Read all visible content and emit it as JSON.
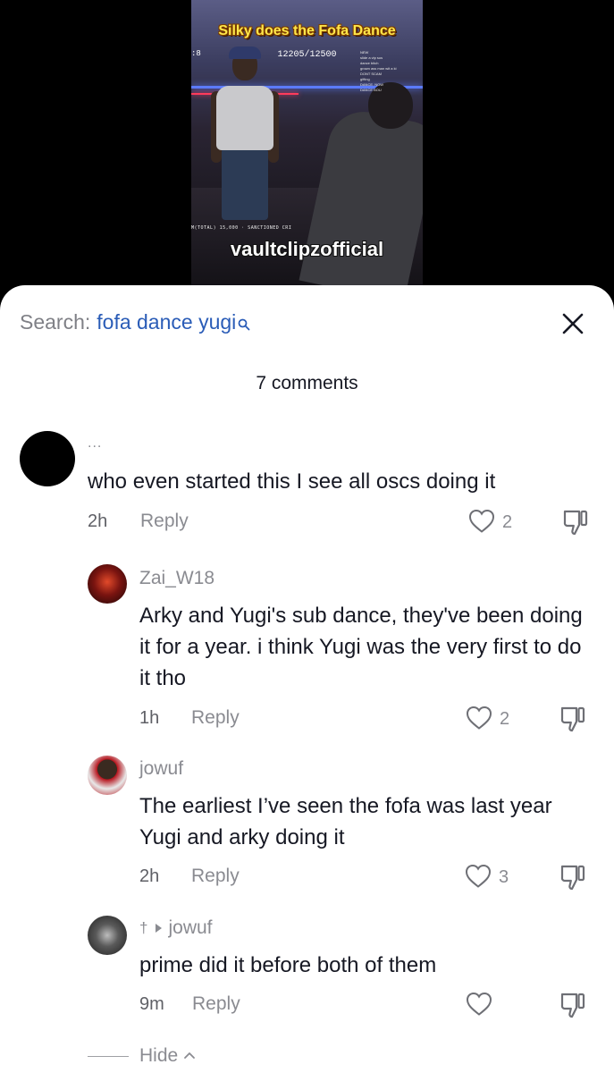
{
  "video": {
    "title": "Silky does the Fofa Dance",
    "counter": "12205/12500",
    "edge_mark": ":8",
    "overlay_text": "M(TOTAL) 15,000 · SANCTIONED CRI",
    "chat_lines": [
      "NEW",
      "slide a vip sus",
      "dance bitch",
      "grown ass man wit a ki",
      "DONT SCAM",
      "gifting",
      "DANCE. NOW",
      "DANCE BOU"
    ],
    "watermark": "vaultclipzofficial"
  },
  "sheet": {
    "search_prefix": "Search:",
    "search_term": "fofa dance yugi",
    "comment_count": "7 comments",
    "hide_label": "Hide",
    "reply_label": "Reply"
  },
  "comments": [
    {
      "user": "...",
      "text": "who even started this I see all oscs doing it",
      "time": "2h",
      "likes": "2",
      "avatar_color": "#000000"
    },
    {
      "user": "Zai_W18",
      "text": "Arky and Yugi's sub dance, they've been doing it for a year. i think Yugi was the very first to do it tho",
      "time": "1h",
      "likes": "2",
      "avatar_color": "#7a1410"
    },
    {
      "user": "jowuf",
      "text": "The earliest I’ve seen the fofa was last year Yugi and arky doing it",
      "time": "2h",
      "likes": "3",
      "avatar_color": "#b5121b"
    },
    {
      "user_prefix": "†",
      "user": "jowuf",
      "text": "prime did it before both of them",
      "time": "9m",
      "likes": "",
      "avatar_color": "#3a3a3a"
    }
  ],
  "colors": {
    "search_term": "#2a5cb7",
    "muted_text": "#8a8b91",
    "primary_text": "#161823"
  }
}
